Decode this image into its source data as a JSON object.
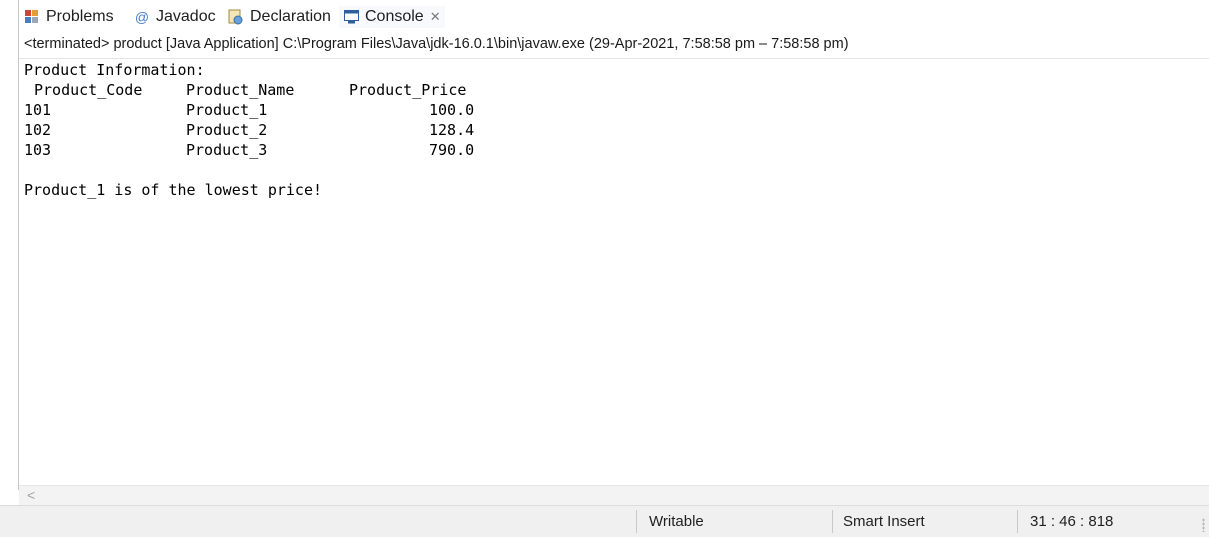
{
  "tabs": [
    {
      "label": "Problems",
      "icon": "problems-icon"
    },
    {
      "label": "Javadoc",
      "icon": "javadoc-icon"
    },
    {
      "label": "Declaration",
      "icon": "declaration-icon"
    },
    {
      "label": "Console",
      "icon": "console-icon",
      "active": true
    }
  ],
  "console": {
    "status_line": "<terminated> product [Java Application] C:\\Program Files\\Java\\jdk-16.0.1\\bin\\javaw.exe  (29-Apr-2021, 7:58:58 pm – 7:58:58 pm)",
    "heading": "Product Information:",
    "columns": [
      "Product_Code",
      "Product_Name",
      "Product_Price"
    ],
    "rows": [
      {
        "code": "101",
        "name": "Product_1",
        "price": "100.0"
      },
      {
        "code": "102",
        "name": "Product_2",
        "price": "128.4"
      },
      {
        "code": "103",
        "name": "Product_3",
        "price": "790.0"
      }
    ],
    "result": "Product_1 is of the lowest price!"
  },
  "statusbar": {
    "mode": "Writable",
    "insert": "Smart Insert",
    "position": "31 : 46 : 818"
  },
  "colors": {
    "active_tab_bg": "#f7f9fc",
    "statusbar_bg": "#f0f0f0"
  }
}
